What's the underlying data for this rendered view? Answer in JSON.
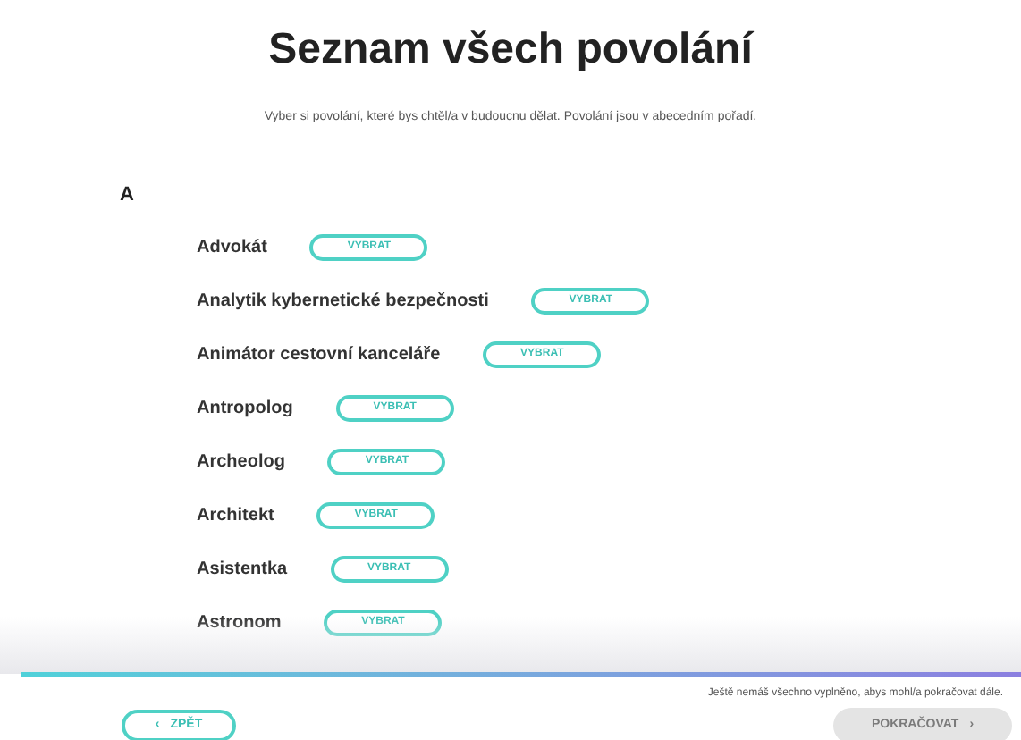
{
  "title": "Seznam všech povolání",
  "subtitle": "Vyber si povolání, které bys chtěl/a v budoucnu dělat. Povolání jsou v abecedním pořadí.",
  "sections": [
    {
      "letter": "A",
      "items": [
        {
          "name": "Advokát",
          "button": "VYBRAT"
        },
        {
          "name": "Analytik kybernetické bezpečnosti",
          "button": "VYBRAT"
        },
        {
          "name": "Animátor cestovní kanceláře",
          "button": "VYBRAT"
        },
        {
          "name": "Antropolog",
          "button": "VYBRAT"
        },
        {
          "name": "Archeolog",
          "button": "VYBRAT"
        },
        {
          "name": "Architekt",
          "button": "VYBRAT"
        },
        {
          "name": "Asistentka",
          "button": "VYBRAT"
        },
        {
          "name": "Astronom",
          "button": "VYBRAT"
        }
      ]
    }
  ],
  "footer": {
    "notice": "Ještě nemáš všechno vyplněno, abys mohl/a pokračovat dále.",
    "back": {
      "icon": "‹",
      "label": "ZPĚT"
    },
    "next": {
      "label": "POKRAČOVAT",
      "icon": "›",
      "disabled": true
    }
  }
}
